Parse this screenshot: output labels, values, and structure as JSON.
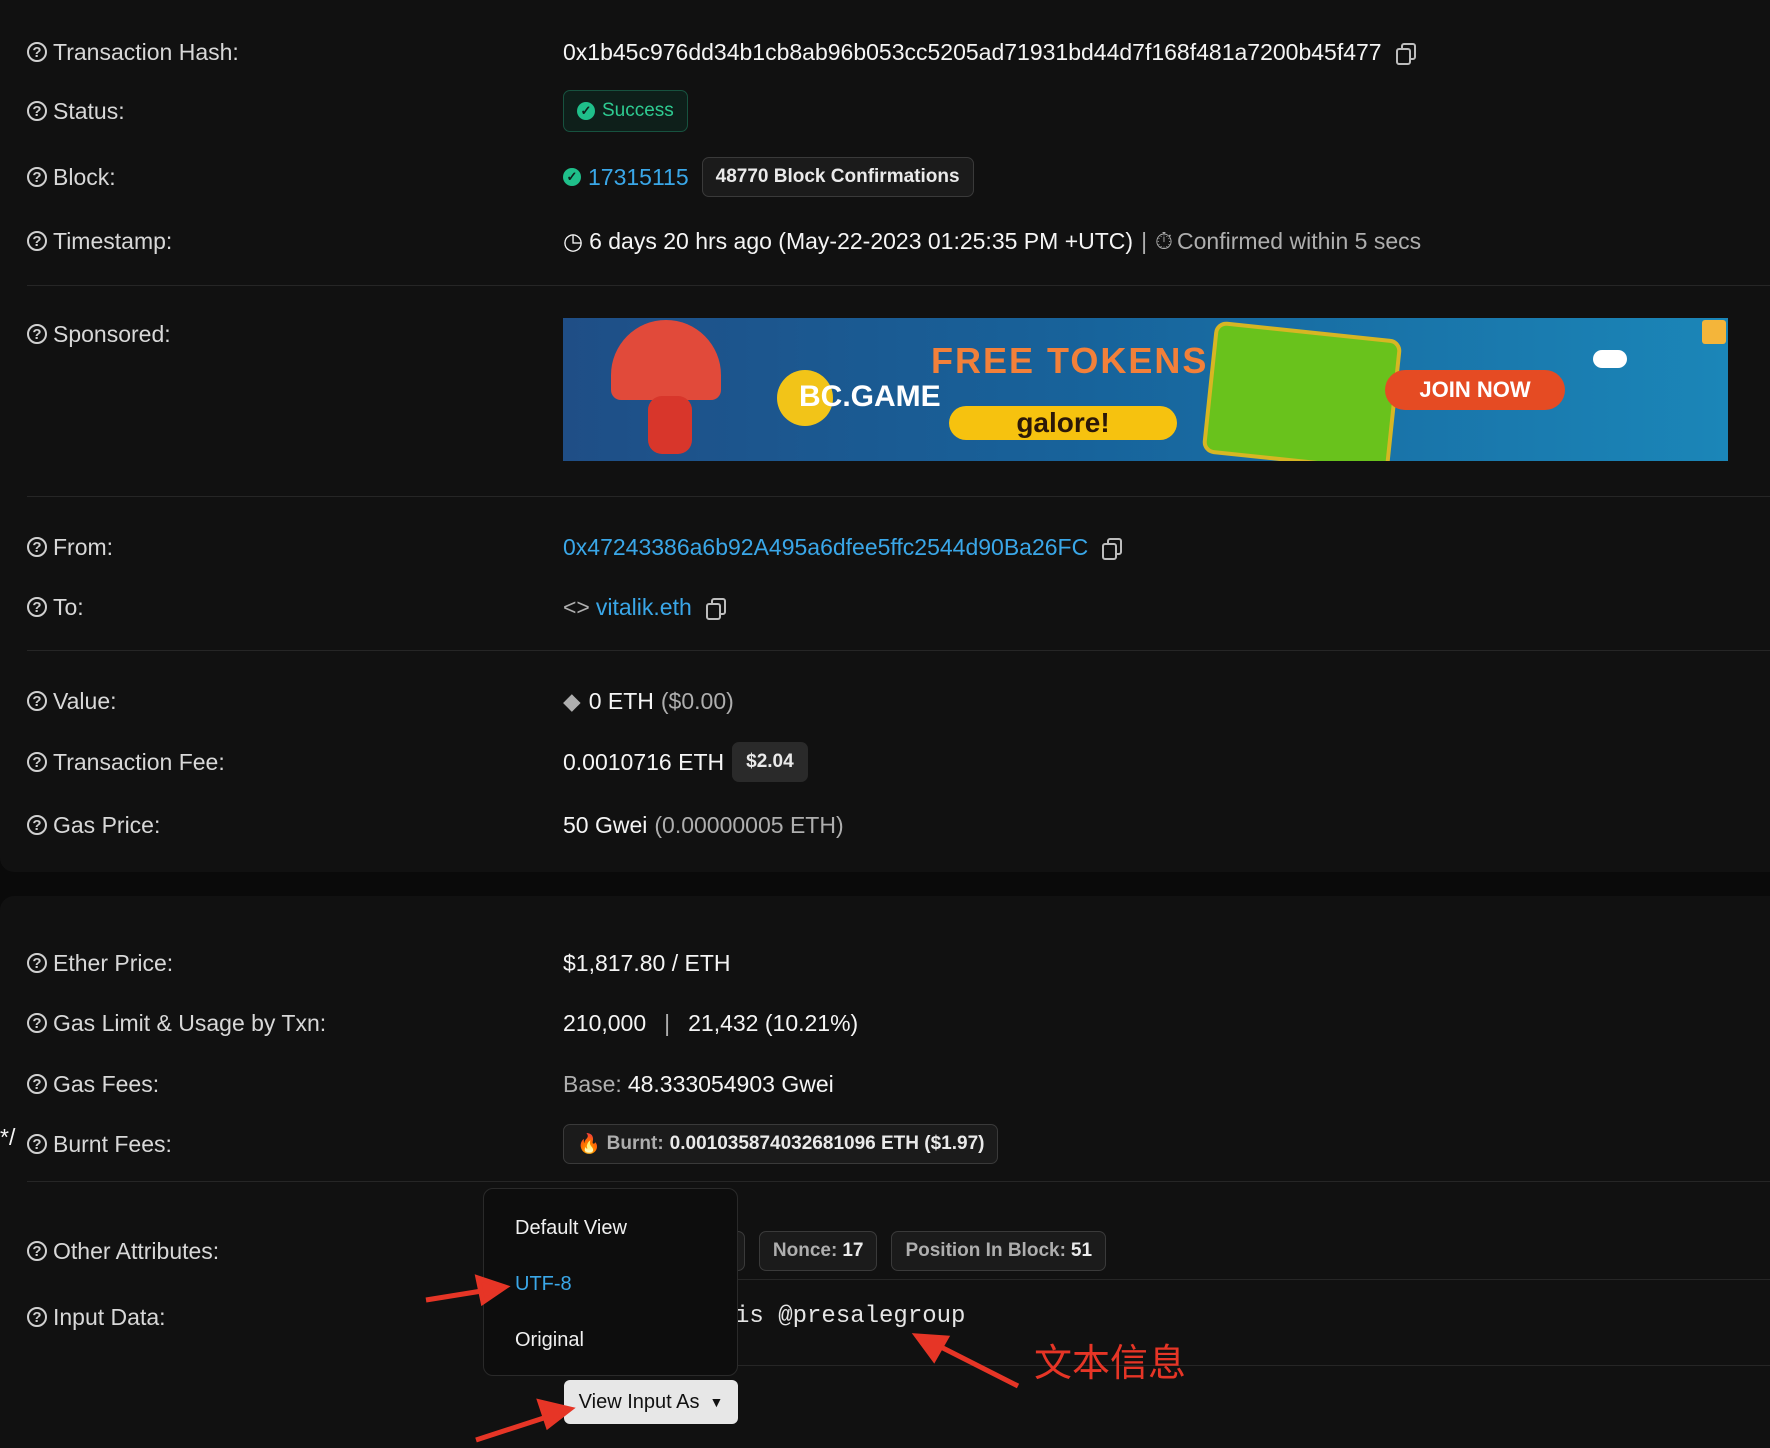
{
  "details": {
    "tx_hash_label": "Transaction Hash:",
    "tx_hash": "0x1b45c976dd34b1cb8ab96b053cc5205ad71931bd44d7f168f481a7200b45f477",
    "status_label": "Status:",
    "status": "Success",
    "block_label": "Block:",
    "block": "17315115",
    "confirmations": "48770 Block Confirmations",
    "timestamp_label": "Timestamp:",
    "timestamp": "6 days 20 hrs ago (May-22-2023 01:25:35 PM +UTC)",
    "confirmed": "Confirmed within 5 secs",
    "sponsored_label": "Sponsored:",
    "from_label": "From:",
    "from": "0x47243386a6b92A495a6dfee5ffc2544d90Ba26FC",
    "to_label": "To:",
    "to": "vitalik.eth",
    "value_label": "Value:",
    "value": "0 ETH",
    "value_usd": "($0.00)",
    "fee_label": "Transaction Fee:",
    "fee": "0.0010716 ETH",
    "fee_usd": "$2.04",
    "gas_price_label": "Gas Price:",
    "gas_price": "50 Gwei",
    "gas_price_eth": "(0.00000005 ETH)"
  },
  "more": {
    "ether_price_label": "Ether Price:",
    "ether_price": "$1,817.80 / ETH",
    "gas_limit_label": "Gas Limit & Usage by Txn:",
    "gas_limit": "210,000",
    "gas_usage": "21,432 (10.21%)",
    "gas_fees_label": "Gas Fees:",
    "base_label": "Base:",
    "base_value": "48.333054903 Gwei",
    "burnt_label_row": "Burnt Fees:",
    "burnt_prefix": "Burnt:",
    "burnt_value": "0.001035874032681096 ETH ($1.97)",
    "other_label": "Other Attributes:",
    "other_partial": "y)",
    "nonce_label": "Nonce:",
    "nonce": "17",
    "position_label": "Position In Block:",
    "position": "51",
    "input_label": "Input Data:",
    "input_partial": "is @presalegroup"
  },
  "ad": {
    "brand": "BC.GAME",
    "headline": "FREE TOKENS",
    "sub": "galore!",
    "cta": "JOIN NOW"
  },
  "dropdown": {
    "options": [
      "Default View",
      "UTF-8",
      "Original"
    ],
    "selected": "UTF-8",
    "button": "View Input As"
  },
  "annotation": "文本信息",
  "colors": {
    "link": "#3aa7e8",
    "success": "#2ecb91",
    "arrow": "#e63526"
  }
}
